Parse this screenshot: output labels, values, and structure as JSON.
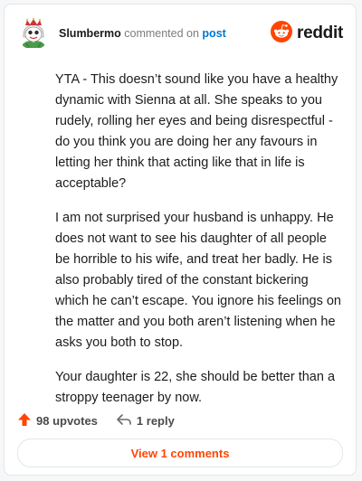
{
  "comment": {
    "username": "Slumbermo",
    "action_text": "commented on",
    "target": "post",
    "paragraphs": [
      "YTA - This doesn’t sound like you have a healthy dynamic with Sienna at all. She speaks to you rudely, rolling her eyes and being disrespectful - do you think you are doing her any favours in letting her think that acting like that in life is acceptable?",
      "I am not surprised your husband is unhappy. He does not want to see his daughter of all people be horrible to his wife, and treat her badly. He is also probably tired of the constant bickering which he can’t escape. You ignore his feelings on the matter and you both aren’t listening when he asks you both to stop.",
      "Your daughter is 22, she should be better than a stroppy teenager by now."
    ]
  },
  "brand": {
    "name": "reddit",
    "icon": "reddit-logo-icon",
    "color": "#ff4500"
  },
  "actions": {
    "upvotes_label": "98 upvotes",
    "reply_label": "1 reply",
    "upvote_icon": "upvote-arrow-icon",
    "reply_icon": "reply-arrow-icon"
  },
  "view_comments_label": "View 1 comments"
}
